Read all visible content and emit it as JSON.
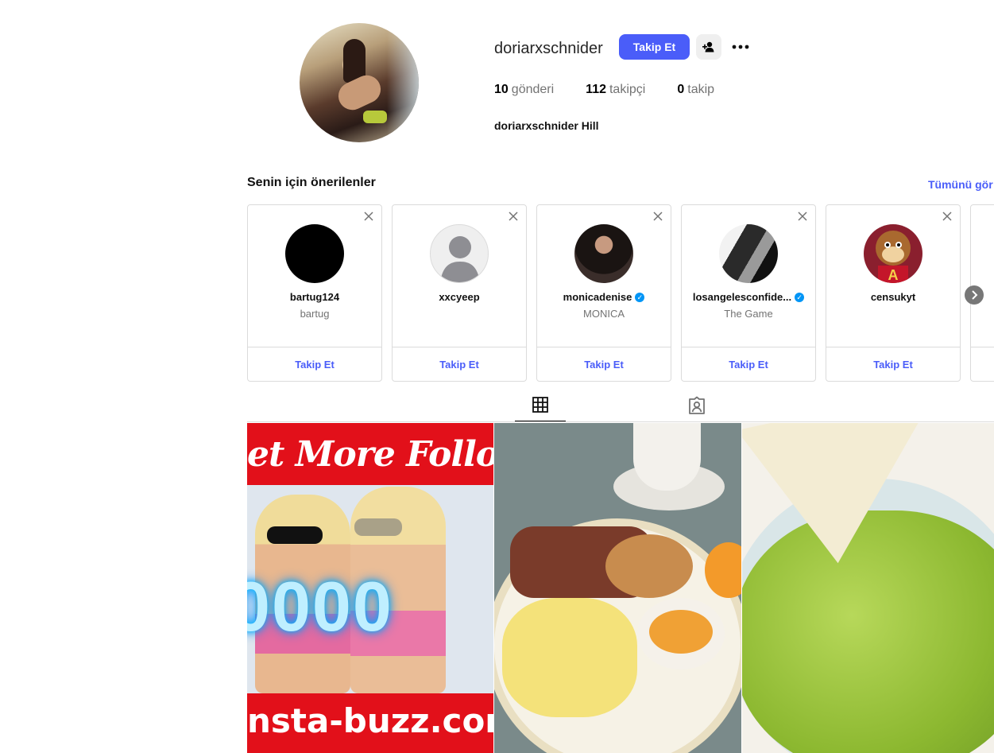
{
  "profile": {
    "username": "doriarxschnider",
    "follow_label": "Takip Et",
    "stats": [
      {
        "count": "10",
        "label": "gönderi"
      },
      {
        "count": "112",
        "label": "takipçi"
      },
      {
        "count": "0",
        "label": "takip"
      }
    ],
    "bio_name": "doriarxschnider Hill"
  },
  "suggestions": {
    "title": "Senin için önerilenler",
    "see_all": "Tümünü gör",
    "cards": [
      {
        "username": "bartug124",
        "subtitle": "bartug",
        "follow": "Takip Et",
        "verified": false
      },
      {
        "username": "xxcyeep",
        "subtitle": "",
        "follow": "Takip Et",
        "verified": false
      },
      {
        "username": "monicadenise",
        "subtitle": "MONICA",
        "follow": "Takip Et",
        "verified": true
      },
      {
        "username": "losangelesconfide...",
        "subtitle": "The Game",
        "follow": "Takip Et",
        "verified": true
      },
      {
        "username": "censukyt",
        "subtitle": "",
        "follow": "Takip Et",
        "verified": false
      }
    ]
  },
  "tabs": [
    {
      "icon": "grid-icon",
      "active": true
    },
    {
      "icon": "tagged-icon",
      "active": false
    }
  ],
  "posts": [
    {
      "top_text": "et More Follower",
      "number_text": "0000",
      "bottom_text": "nsta-buzz.com"
    },
    {
      "top_text": "",
      "number_text": "",
      "bottom_text": ""
    },
    {
      "top_text": "",
      "number_text": "",
      "bottom_text": ""
    }
  ],
  "colors": {
    "accent": "#4a5df9",
    "verified": "#0095f6",
    "border": "#dbdbdb",
    "muted": "#737373"
  }
}
